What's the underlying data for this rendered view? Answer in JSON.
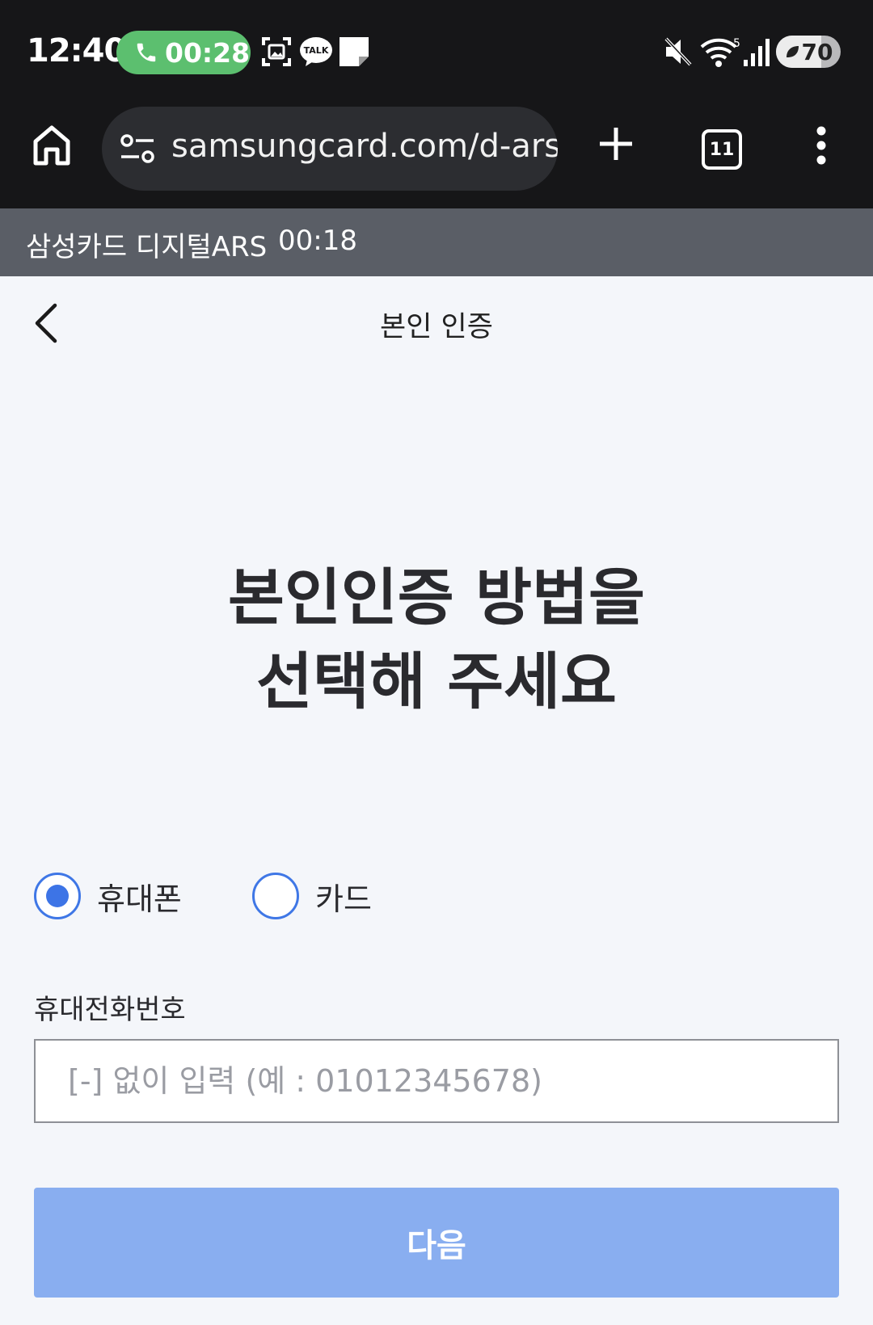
{
  "status_bar": {
    "time": "12:40",
    "call_timer": "00:28",
    "talk_label": "TALK",
    "wifi_badge": "5",
    "battery_level": 70,
    "battery_label": "70",
    "call_color": "#5cbf6f"
  },
  "browser": {
    "url": "samsungcard.com/d-ars",
    "tab_count": "11",
    "icons": [
      "home-icon",
      "site-settings-icon",
      "new-tab-icon",
      "tab-switcher-icon",
      "more-menu-icon"
    ]
  },
  "ars_banner": {
    "title": "삼성카드 디지털ARS",
    "timer": "00:18"
  },
  "page": {
    "title": "본인 인증",
    "headline_line1": "본인인증 방법을",
    "headline_line2": "선택해 주세요",
    "radio_phone_label": "휴대폰",
    "radio_card_label": "카드",
    "selected_method": "휴대폰",
    "phone_field_label": "휴대전화번호",
    "phone_placeholder": "[-] 없이 입력 (예 : 01012345678)",
    "phone_value": "",
    "next_label": "다음",
    "accent_color": "#3d74e6",
    "next_button_color": "#89aef0"
  }
}
